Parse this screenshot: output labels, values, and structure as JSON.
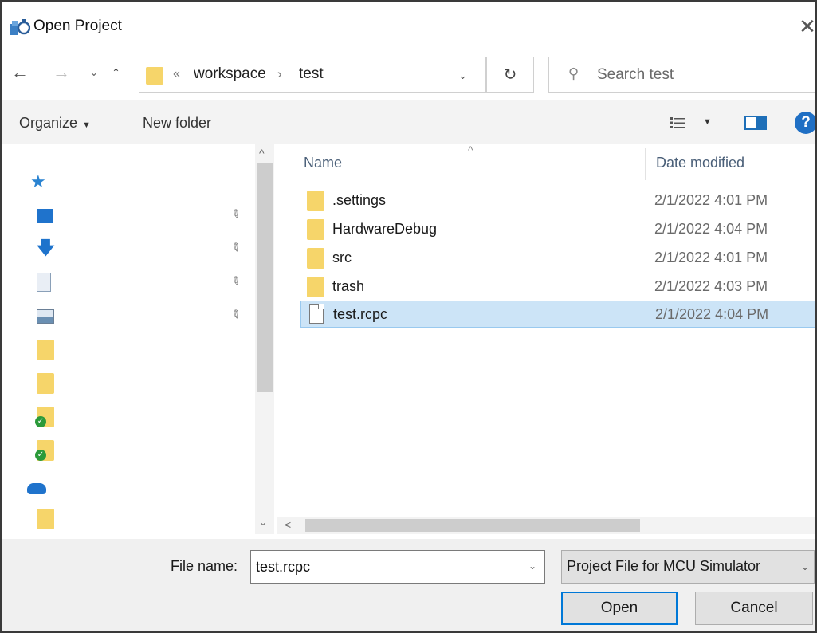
{
  "window": {
    "title": "Open Project",
    "close_glyph": "✕"
  },
  "navbar": {
    "back_glyph": "←",
    "forward_glyph": "→",
    "recent_glyph": "⌄",
    "up_glyph": "↑",
    "address": {
      "chevron": "«",
      "segments": [
        "workspace",
        "test"
      ],
      "separator": "›",
      "dropdown_glyph": "⌄"
    },
    "refresh_glyph": "↻",
    "search": {
      "placeholder": "Search test",
      "value": ""
    }
  },
  "commandbar": {
    "organize_label": "Organize",
    "organize_caret": "▼",
    "new_folder_label": "New folder",
    "view_caret": "▼",
    "help_glyph": "?"
  },
  "navpane": {
    "icons": [
      "star-icon",
      "desktop-icon",
      "downloads-icon",
      "document-icon",
      "pictures-icon",
      "folder-icon",
      "folder-icon",
      "folder-synced-icon",
      "folder-synced-icon",
      "cloud-icon",
      "folder-icon"
    ],
    "pin_glyph": "📌",
    "scroll_up": "^",
    "scroll_down": "⌄"
  },
  "filelist": {
    "columns": {
      "name": "Name",
      "date": "Date modified"
    },
    "sort_glyph": "^",
    "rows": [
      {
        "name": ".settings",
        "date": "2/1/2022 4:01 PM",
        "type": "folder"
      },
      {
        "name": "HardwareDebug",
        "date": "2/1/2022 4:04 PM",
        "type": "folder"
      },
      {
        "name": "src",
        "date": "2/1/2022 4:01 PM",
        "type": "folder"
      },
      {
        "name": "trash",
        "date": "2/1/2022 4:03 PM",
        "type": "folder"
      },
      {
        "name": "test.rcpc",
        "date": "2/1/2022 4:04 PM",
        "type": "file",
        "selected": true
      }
    ],
    "hscroll_left": "<"
  },
  "footer": {
    "file_name_label": "File name:",
    "file_name_value": "test.rcpc",
    "file_name_caret": "⌄",
    "filter_value": "Project File for MCU Simulator",
    "filter_caret": "⌄",
    "open_label": "Open",
    "cancel_label": "Cancel"
  },
  "colors": {
    "selection": "#cce4f7",
    "folder": "#f6d56a",
    "accent": "#0078d7"
  }
}
